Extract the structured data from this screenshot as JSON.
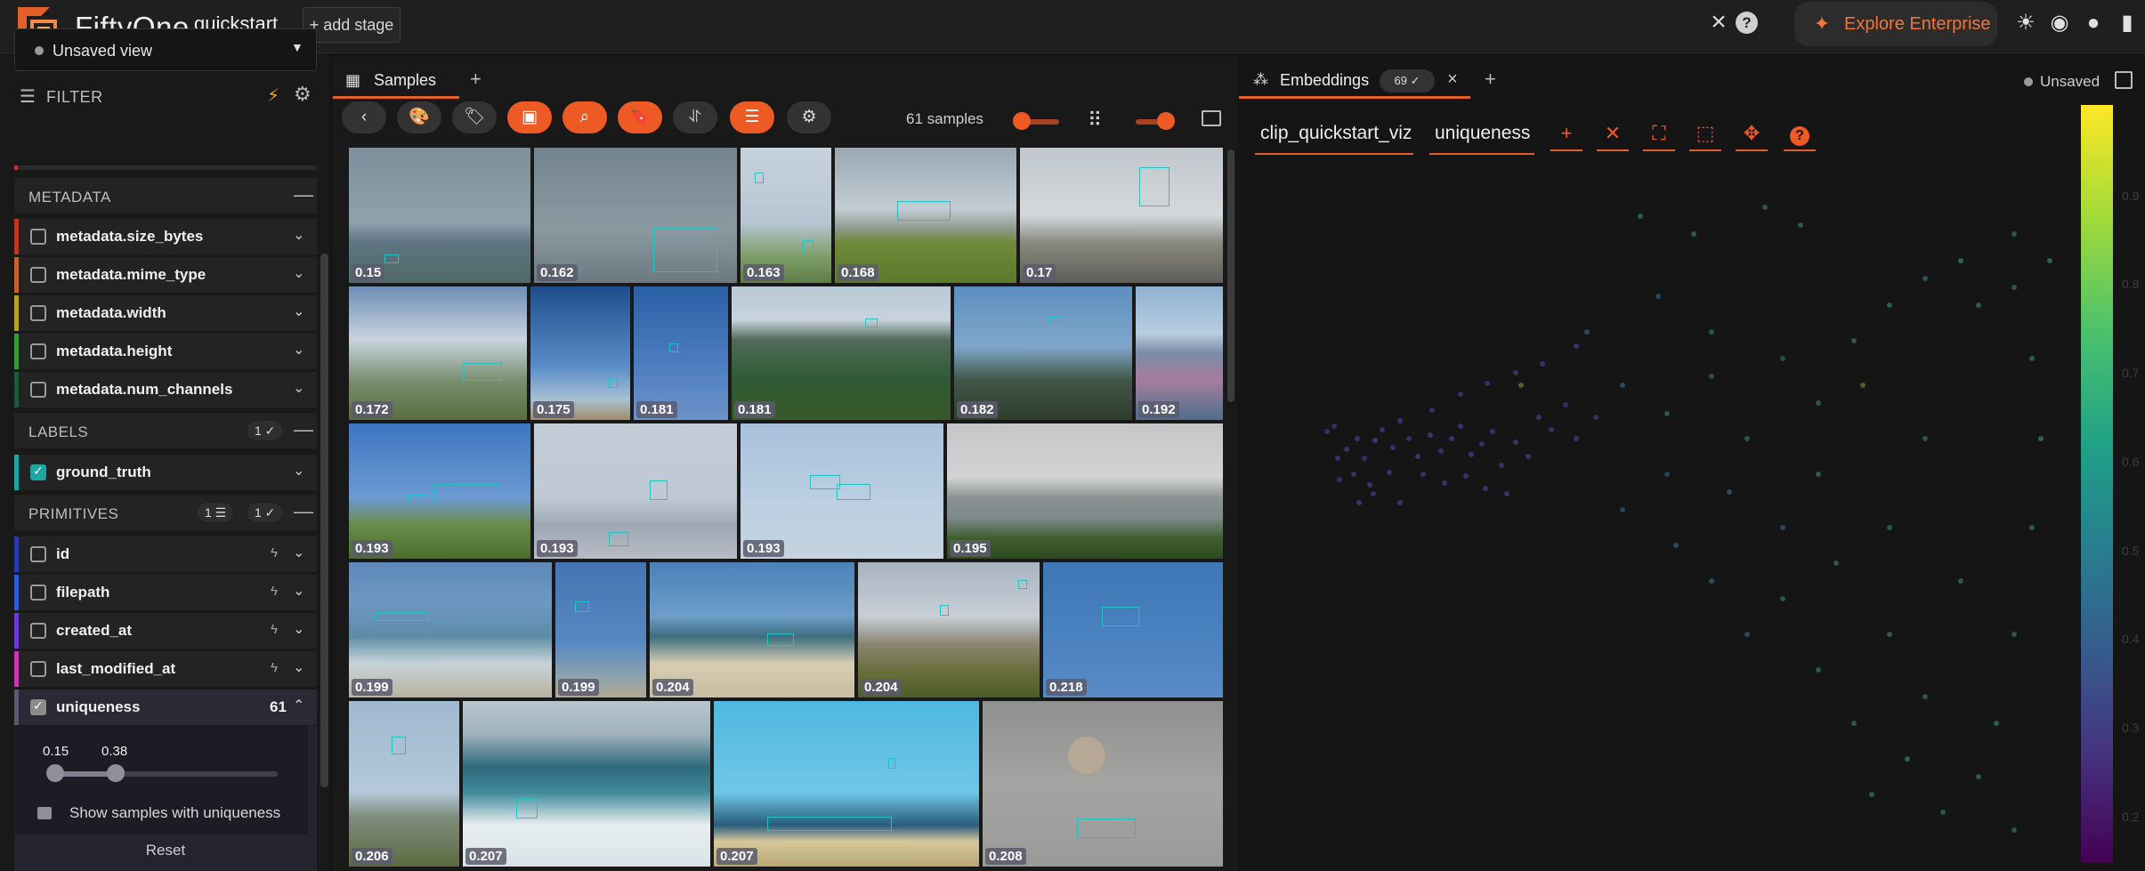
{
  "app": {
    "name": "FiftyOne",
    "dataset": "quickstart",
    "add_stage": "+ add stage",
    "explore": "Explore Enterprise"
  },
  "sidebar": {
    "view": "Unsaved view",
    "filter_label": "FILTER",
    "metadata_section": "METADATA",
    "metadata_fields": [
      "metadata.size_bytes",
      "metadata.mime_type",
      "metadata.width",
      "metadata.height",
      "metadata.num_channels"
    ],
    "labels_section": "LABELS",
    "labels_badge": "1 ✓",
    "label_fields": [
      "ground_truth"
    ],
    "primitives_section": "PRIMITIVES",
    "primitives_badge_a": "1 ☰",
    "primitives_badge_b": "1 ✓",
    "primitive_fields": [
      "id",
      "filepath",
      "created_at",
      "last_modified_at"
    ],
    "uniqueness": {
      "name": "uniqueness",
      "count": "61",
      "min": "0.15",
      "max": "0.38",
      "show_label": "Show samples with uniqueness",
      "reset": "Reset"
    }
  },
  "samples": {
    "tab": "Samples",
    "count": "61 samples",
    "tiles": [
      "0.15",
      "0.162",
      "0.163",
      "0.168",
      "0.17",
      "0.172",
      "0.175",
      "0.181",
      "0.181",
      "0.182",
      "0.192",
      "0.193",
      "0.193",
      "0.193",
      "0.195",
      "0.199",
      "0.199",
      "0.204",
      "0.204",
      "0.218",
      "0.206",
      "0.207",
      "0.207",
      "0.208"
    ]
  },
  "embeddings": {
    "tab": "Embeddings",
    "badge": "69 ✓",
    "status": "Unsaved",
    "brain_key": "clip_quickstart_viz",
    "color_by": "uniqueness",
    "colorbar_ticks": [
      "0.9",
      "0.8",
      "0.7",
      "0.6",
      "0.5",
      "0.4",
      "0.3",
      "0.2"
    ]
  }
}
